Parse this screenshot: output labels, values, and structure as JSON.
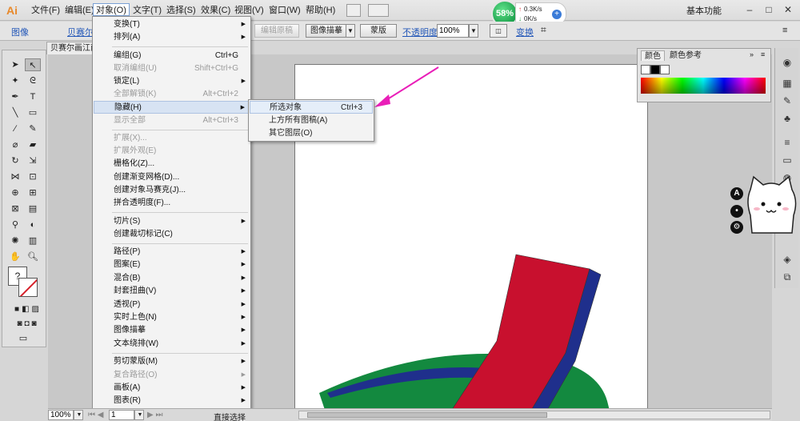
{
  "app": {
    "logo": "Ai",
    "menu": [
      "文件(F)",
      "编辑(E)",
      "对象(O)",
      "文字(T)",
      "选择(S)",
      "效果(C)",
      "视图(V)",
      "窗口(W)",
      "帮助(H)"
    ],
    "workspace": "基本功能",
    "window_buttons": [
      "–",
      "□",
      "✕"
    ]
  },
  "control_bar": {
    "left_label": "图像",
    "link_label": "贝赛尔",
    "btn_embed": "嵌入",
    "btn_edit_original": "编辑原稿",
    "btn_image_trace": "图像描摹",
    "btn_mask": "蒙版",
    "opacity_label": "不透明度:",
    "opacity_value": "100%",
    "transform_label": "变换"
  },
  "document": {
    "tab_title": "贝赛尔画江南"
  },
  "speed_widget": {
    "percent": "58%",
    "upload": "0.3K/s",
    "download": "0K/s"
  },
  "object_menu": {
    "items": [
      {
        "label": "变换(T)",
        "shortcut": "",
        "submenu": true,
        "disabled": false
      },
      {
        "label": "排列(A)",
        "shortcut": "",
        "submenu": true,
        "disabled": false
      },
      {
        "label": "编组(G)",
        "shortcut": "Ctrl+G",
        "submenu": false,
        "disabled": false
      },
      {
        "label": "取消编组(U)",
        "shortcut": "Shift+Ctrl+G",
        "submenu": false,
        "disabled": true
      },
      {
        "label": "锁定(L)",
        "shortcut": "",
        "submenu": true,
        "disabled": false
      },
      {
        "label": "全部解锁(K)",
        "shortcut": "Alt+Ctrl+2",
        "submenu": false,
        "disabled": true
      },
      {
        "label": "隐藏(H)",
        "shortcut": "",
        "submenu": true,
        "disabled": false
      },
      {
        "label": "显示全部",
        "shortcut": "Alt+Ctrl+3",
        "submenu": false,
        "disabled": true
      },
      {
        "label": "扩展(X)...",
        "shortcut": "",
        "submenu": false,
        "disabled": true
      },
      {
        "label": "扩展外观(E)",
        "shortcut": "",
        "submenu": false,
        "disabled": true
      },
      {
        "label": "栅格化(Z)...",
        "shortcut": "",
        "submenu": false,
        "disabled": false
      },
      {
        "label": "创建渐变网格(D)...",
        "shortcut": "",
        "submenu": false,
        "disabled": false
      },
      {
        "label": "创建对象马赛克(J)...",
        "shortcut": "",
        "submenu": false,
        "disabled": false
      },
      {
        "label": "拼合透明度(F)...",
        "shortcut": "",
        "submenu": false,
        "disabled": false
      },
      {
        "label": "切片(S)",
        "shortcut": "",
        "submenu": true,
        "disabled": false
      },
      {
        "label": "创建裁切标记(C)",
        "shortcut": "",
        "submenu": false,
        "disabled": false
      },
      {
        "label": "路径(P)",
        "shortcut": "",
        "submenu": true,
        "disabled": false
      },
      {
        "label": "图案(E)",
        "shortcut": "",
        "submenu": true,
        "disabled": false
      },
      {
        "label": "混合(B)",
        "shortcut": "",
        "submenu": true,
        "disabled": false
      },
      {
        "label": "封套扭曲(V)",
        "shortcut": "",
        "submenu": true,
        "disabled": false
      },
      {
        "label": "透视(P)",
        "shortcut": "",
        "submenu": true,
        "disabled": false
      },
      {
        "label": "实时上色(N)",
        "shortcut": "",
        "submenu": true,
        "disabled": false
      },
      {
        "label": "图像描摹",
        "shortcut": "",
        "submenu": true,
        "disabled": false
      },
      {
        "label": "文本绕排(W)",
        "shortcut": "",
        "submenu": true,
        "disabled": false
      },
      {
        "label": "剪切蒙版(M)",
        "shortcut": "",
        "submenu": true,
        "disabled": false
      },
      {
        "label": "复合路径(O)",
        "shortcut": "",
        "submenu": true,
        "disabled": true
      },
      {
        "label": "画板(A)",
        "shortcut": "",
        "submenu": true,
        "disabled": false
      },
      {
        "label": "图表(R)",
        "shortcut": "",
        "submenu": true,
        "disabled": false
      }
    ]
  },
  "hide_submenu": {
    "items": [
      {
        "label": "所选对象",
        "shortcut": "Ctrl+3"
      },
      {
        "label": "上方所有图稿(A)",
        "shortcut": ""
      },
      {
        "label": "其它图层(O)",
        "shortcut": ""
      }
    ]
  },
  "color_panel": {
    "tabs": [
      "颜色",
      "颜色参考"
    ]
  },
  "status_bar": {
    "zoom": "100%",
    "artboard": "1",
    "tool": "直接选择"
  },
  "colors": {
    "red_stripe": "#c8102e",
    "blue_stripe": "#1f2f8c",
    "green_arc": "#13893f",
    "arrow": "#e91eb8"
  }
}
